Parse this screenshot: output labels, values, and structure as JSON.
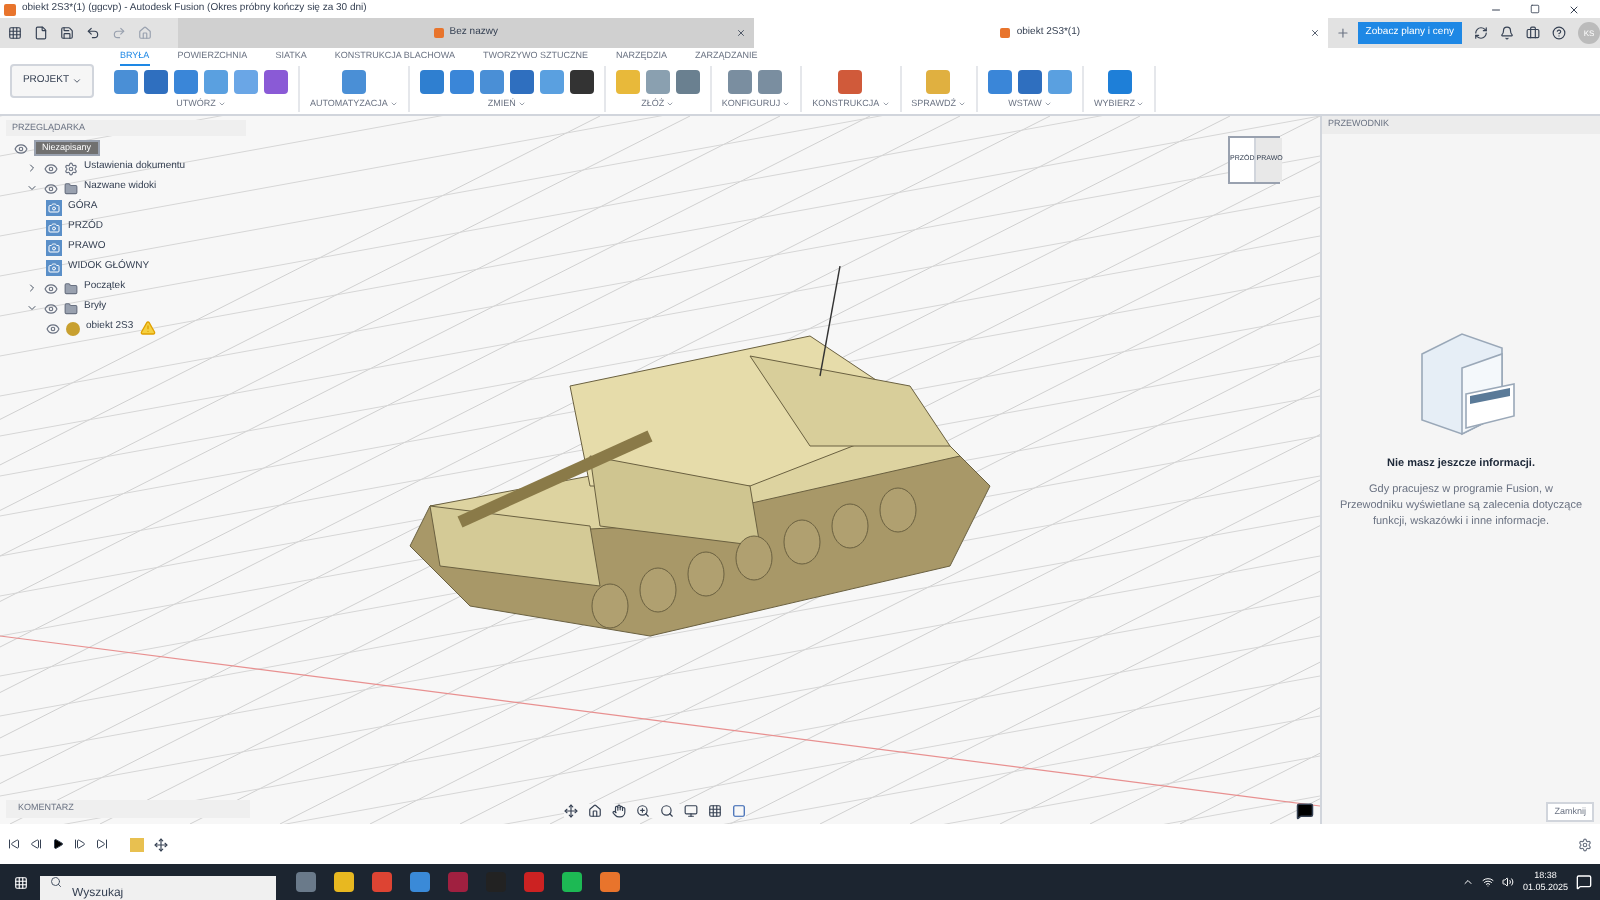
{
  "window": {
    "title": "obiekt 2S3*(1) (ggcvp) - Autodesk Fusion (Okres próbny kończy się za 30 dni)"
  },
  "doc_tabs": [
    {
      "label": "Bez nazwy",
      "selected": false
    },
    {
      "label": "obiekt 2S3*(1)",
      "selected": true
    }
  ],
  "plans_button": "Zobacz plany i ceny",
  "user_initials": "KS",
  "project_button": "PROJEKT",
  "workspace_tabs": [
    {
      "label": "BRYŁA",
      "selected": true
    },
    {
      "label": "POWIERZCHNIA",
      "selected": false
    },
    {
      "label": "SIATKA",
      "selected": false
    },
    {
      "label": "KONSTRUKCJA BLACHOWA",
      "selected": false
    },
    {
      "label": "TWORZYWO SZTUCZNE",
      "selected": false
    },
    {
      "label": "NARZĘDZIA",
      "selected": false
    },
    {
      "label": "ZARZĄDZANIE",
      "selected": false
    }
  ],
  "tool_groups": [
    {
      "label": "UTWÓRZ"
    },
    {
      "label": "AUTOMATYZACJA"
    },
    {
      "label": "ZMIEŃ"
    },
    {
      "label": "ZŁÓŻ"
    },
    {
      "label": "KONFIGURUJ"
    },
    {
      "label": "KONSTRUKCJA"
    },
    {
      "label": "SPRAWDŹ"
    },
    {
      "label": "WSTAW"
    },
    {
      "label": "WYBIERZ"
    }
  ],
  "browser": {
    "title": "PRZEGLĄDARKA",
    "root": "Niezapisany",
    "items": [
      {
        "label": "Ustawienia dokumentu",
        "kind": "settings",
        "expanded": false
      },
      {
        "label": "Nazwane widoki",
        "kind": "folder",
        "expanded": true,
        "children": [
          {
            "label": "GÓRA",
            "kind": "view"
          },
          {
            "label": "PRZÓD",
            "kind": "view"
          },
          {
            "label": "PRAWO",
            "kind": "view"
          },
          {
            "label": "WIDOK GŁÓWNY",
            "kind": "view"
          }
        ]
      },
      {
        "label": "Początek",
        "kind": "folder",
        "expanded": false
      },
      {
        "label": "Bryły",
        "kind": "folder",
        "expanded": true,
        "children": [
          {
            "label": "obiekt 2S3",
            "kind": "body"
          }
        ]
      }
    ]
  },
  "view_cube": {
    "front": "PRZÓD",
    "right": "PRAWO"
  },
  "guide": {
    "title": "PRZEWODNIK",
    "heading": "Nie masz jeszcze informacji.",
    "text": "Gdy pracujesz w programie Fusion, w Przewodniku wyświetlane są zalecenia dotyczące funkcji, wskazówki i inne informacje.",
    "close_button": "Zamknij"
  },
  "comments": {
    "title": "KOMENTARZ"
  },
  "taskbar": {
    "search_placeholder": "Wyszukaj",
    "time": "18:38",
    "date": "01.05.2025"
  }
}
